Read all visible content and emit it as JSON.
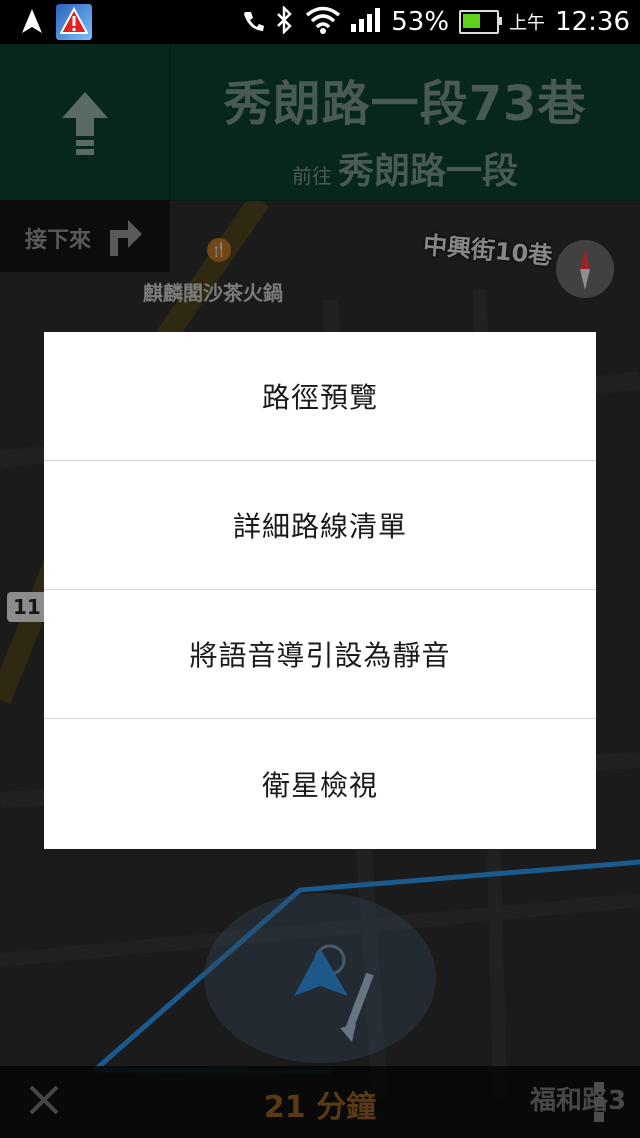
{
  "status_bar": {
    "battery_percent": "53%",
    "am_pm": "上午",
    "time": "12:36",
    "battery_level": 0.53,
    "icons": [
      "navigation-arrow-icon",
      "warning-app-icon",
      "vibrate-icon",
      "bluetooth-icon",
      "wifi-icon",
      "signal-icon",
      "battery-icon"
    ]
  },
  "navigation": {
    "street_name": "秀朗路一段73巷",
    "toward_prefix": "前往",
    "toward_street": "秀朗路一段",
    "next_turn_label": "接下來",
    "next_turn_icon": "turn-right-icon",
    "maneuver_icon": "straight-arrow-icon",
    "header_color": "#0c3b2c"
  },
  "map": {
    "street_label": "中興街10巷",
    "poi_name": "麒麟閣沙茶火鍋",
    "road_number": "11"
  },
  "menu": {
    "items": [
      {
        "label": "路徑預覽"
      },
      {
        "label": "詳細路線清單"
      },
      {
        "label": "將語音導引設為靜音"
      },
      {
        "label": "衛星檢視"
      }
    ]
  },
  "bottom_bar": {
    "eta": "21 分鐘",
    "street": "福和路3",
    "eta_color": "#8a5a20"
  }
}
